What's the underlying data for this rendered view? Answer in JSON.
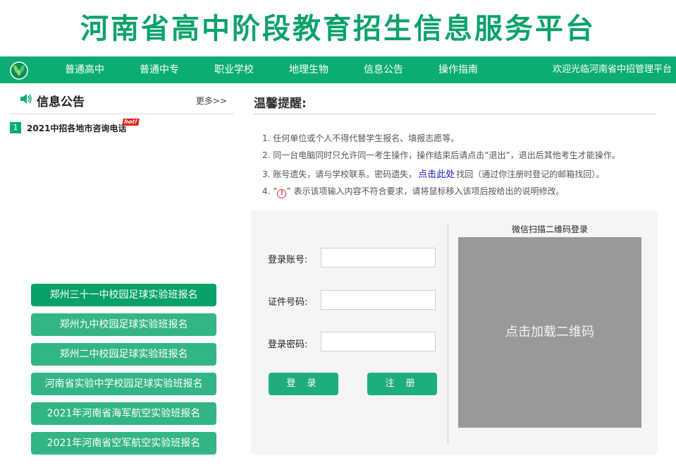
{
  "header": {
    "title": "河南省高中阶段教育招生信息服务平台"
  },
  "nav": {
    "items": [
      "普通高中",
      "普通中专",
      "职业学校",
      "地理生物",
      "信息公告",
      "操作指南"
    ],
    "welcome": "欢迎光临河南省中招管理平台"
  },
  "notice": {
    "title": "信息公告",
    "more": "更多>>",
    "items": [
      {
        "num": "1",
        "text": "2021中招各地市咨询电话",
        "badge": "hot!"
      }
    ]
  },
  "registration_buttons": [
    "郑州三十一中校园足球实验班报名",
    "郑州九中校园足球实验班报名",
    "郑州二中校园足球实验班报名",
    "河南省实验中学校园足球实验班报名",
    "2021年河南省海军航空实验班报名",
    "2021年河南省空军航空实验班报名"
  ],
  "tips": {
    "title": "温馨提醒:",
    "t1": "1.  任何单位或个人不得代替学生报名、填报志愿等。",
    "t2": "2.  同一台电脑同时只允许同一考生操作，操作结束后请点击“退出”，退出后其他考生才能操作。",
    "t3_pre": "3.  账号遗失，请与学校联系。密码遗失，",
    "t3_link": "点击此处",
    "t3_post": "找回（通过你注册时登记的邮箱找回）。",
    "t4_pre": "4.   “",
    "t4_icon": "!",
    "t4_post": "” 表示该项输入内容不符合要求，请将鼠标移入该项后按给出的说明修改。"
  },
  "login": {
    "account_label": "登录账号:",
    "id_label": "证件号码:",
    "password_label": "登录密码:",
    "account_value": "",
    "id_value": "",
    "password_value": "",
    "login_button": "登 录",
    "register_button": "注 册",
    "qr_caption": "微信扫描二维码登录",
    "qr_placeholder": "点击加载二维码"
  },
  "colors": {
    "brand": "#0bae70",
    "button": "#33b585",
    "link": "#1a1acc",
    "warning": "#e03030"
  },
  "icons": {
    "nav_logo": "leaf-logo-icon",
    "notice": "speaker-icon",
    "warning": "warning-circle-icon"
  }
}
